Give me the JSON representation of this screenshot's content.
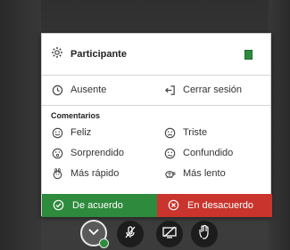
{
  "menu": {
    "header": {
      "icon": "gear-icon",
      "label": "Participante",
      "indicator_color": "#2e8b3e"
    },
    "status": [
      {
        "icon": "clock-icon",
        "label": "Ausente"
      },
      {
        "icon": "logout-icon",
        "label": "Cerrar sesión"
      }
    ],
    "comments_title": "Comentarios",
    "comments": [
      {
        "icon": "happy-face-icon",
        "label": "Feliz"
      },
      {
        "icon": "sad-face-icon",
        "label": "Triste"
      },
      {
        "icon": "surprised-face-icon",
        "label": "Sorprendido"
      },
      {
        "icon": "confused-face-icon",
        "label": "Confundido"
      },
      {
        "icon": "rabbit-icon",
        "label": "Más rápido"
      },
      {
        "icon": "turtle-icon",
        "label": "Más lento"
      }
    ],
    "agree": {
      "icon": "check-circle-icon",
      "label": "De acuerdo",
      "color": "#2e8a3c"
    },
    "disagree": {
      "icon": "x-circle-icon",
      "label": "En desacuerdo",
      "color": "#c9342d"
    }
  },
  "toolbar": {
    "buttons": [
      {
        "icon": "chevron-down-icon",
        "active": true
      },
      {
        "icon": "mic-off-icon"
      },
      {
        "icon": "screen-share-off-icon"
      },
      {
        "icon": "raise-hand-icon"
      }
    ]
  }
}
